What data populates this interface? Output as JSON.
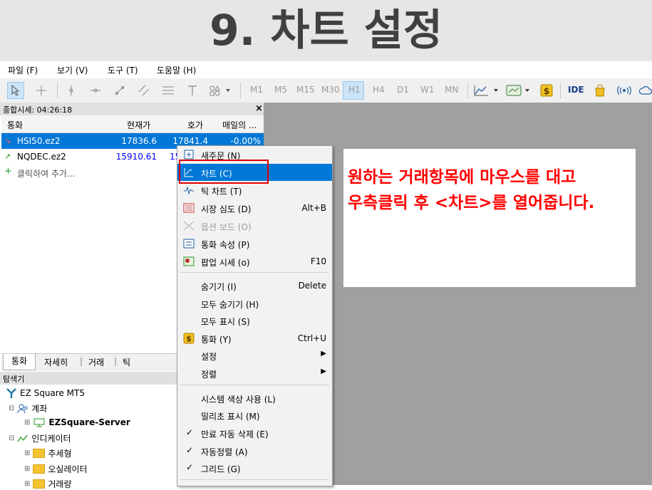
{
  "title": "9. 차트 설정",
  "menu": [
    "파일 (F)",
    "보기 (V)",
    "도구 (T)",
    "도움말 (H)"
  ],
  "toolbar": {
    "timeframes": [
      "M1",
      "M5",
      "M15",
      "M30",
      "H1",
      "H4",
      "D1",
      "W1",
      "MN"
    ],
    "active_timeframe": "H1",
    "ide_label": "IDE",
    "icons": [
      "cursor-icon",
      "crosshair-icon",
      "vertical-line-icon",
      "horizontal-line-icon",
      "trend-line-icon",
      "channel-icon",
      "fibonacci-icon",
      "text-icon",
      "shapes-icon",
      "chart-type-icon",
      "template-icon",
      "dollar-icon",
      "ide-icon",
      "market-bag-icon",
      "signals-icon",
      "cloud-icon"
    ]
  },
  "market_watch": {
    "title": "종합시세: 04:26:18",
    "close": "×",
    "columns": [
      "통화",
      "현재가",
      "호가",
      "매일의 ..."
    ],
    "rows": [
      {
        "symbol": "HSI50.ez2",
        "bid": "17836.6",
        "ask": "17841.4",
        "daily": "-0.00%",
        "selected": true
      },
      {
        "symbol": "NQDEC.ez2",
        "bid": "15910.61",
        "ask": "15",
        "daily": "",
        "selected": false
      }
    ],
    "add_label": "클릭하여 추가...",
    "tabs": [
      "통화",
      "자세히",
      "거래",
      "틱"
    ]
  },
  "navigator": {
    "title": "탐색기",
    "items": [
      {
        "label": "EZ Square MT5",
        "level": 0
      },
      {
        "label": "계좌",
        "level": 1
      },
      {
        "label": "EZSquare-Server",
        "level": 2
      },
      {
        "label": "인디케이터",
        "level": 1
      },
      {
        "label": "추세형",
        "level": 2
      },
      {
        "label": "오실레이터",
        "level": 2
      },
      {
        "label": "거래량",
        "level": 2
      }
    ]
  },
  "context_menu": {
    "items": [
      {
        "label": "새주문 (N)",
        "shortcut": "",
        "icon": "new-order-icon"
      },
      {
        "label": "차트 (C)",
        "shortcut": "",
        "icon": "chart-icon",
        "highlighted": true
      },
      {
        "label": "틱 차트 (T)",
        "shortcut": "",
        "icon": "tick-chart-icon"
      },
      {
        "label": "시장 심도 (D)",
        "shortcut": "Alt+B",
        "icon": "depth-icon"
      },
      {
        "label": "옵션 보드 (O)",
        "shortcut": "",
        "icon": "options-icon",
        "disabled": true
      },
      {
        "label": "통화 속성 (P)",
        "shortcut": "",
        "icon": "properties-icon"
      },
      {
        "label": "팝업 시세 (o)",
        "shortcut": "F10",
        "icon": "popup-icon"
      },
      {
        "label": "숨기기 (I)",
        "shortcut": "Delete"
      },
      {
        "label": "모두 숨기기 (H)",
        "shortcut": ""
      },
      {
        "label": "모두 표시 (S)",
        "shortcut": ""
      },
      {
        "label": "통화 (Y)",
        "shortcut": "Ctrl+U",
        "icon": "dollar-icon"
      },
      {
        "label": "설정",
        "submenu": true
      },
      {
        "label": "정렬",
        "submenu": true
      },
      {
        "label": "시스템 색상 사용 (L)",
        "shortcut": ""
      },
      {
        "label": "밀리초 표시 (M)",
        "shortcut": ""
      },
      {
        "label": "만료 자동 삭제 (E)",
        "checked": true
      },
      {
        "label": "자동정렬 (A)",
        "checked": true
      },
      {
        "label": "그리드 (G)",
        "checked": true
      }
    ]
  },
  "annotation": {
    "line1": "원하는 거래항목에 마우스를 대고",
    "line2": "우측클릭 후 <차트>를 열어줍니다."
  },
  "colors": {
    "accent": "#0078d7",
    "highlight_box": "#e00000",
    "annotation_text": "#ff0000",
    "blue_price": "#0000ff"
  }
}
